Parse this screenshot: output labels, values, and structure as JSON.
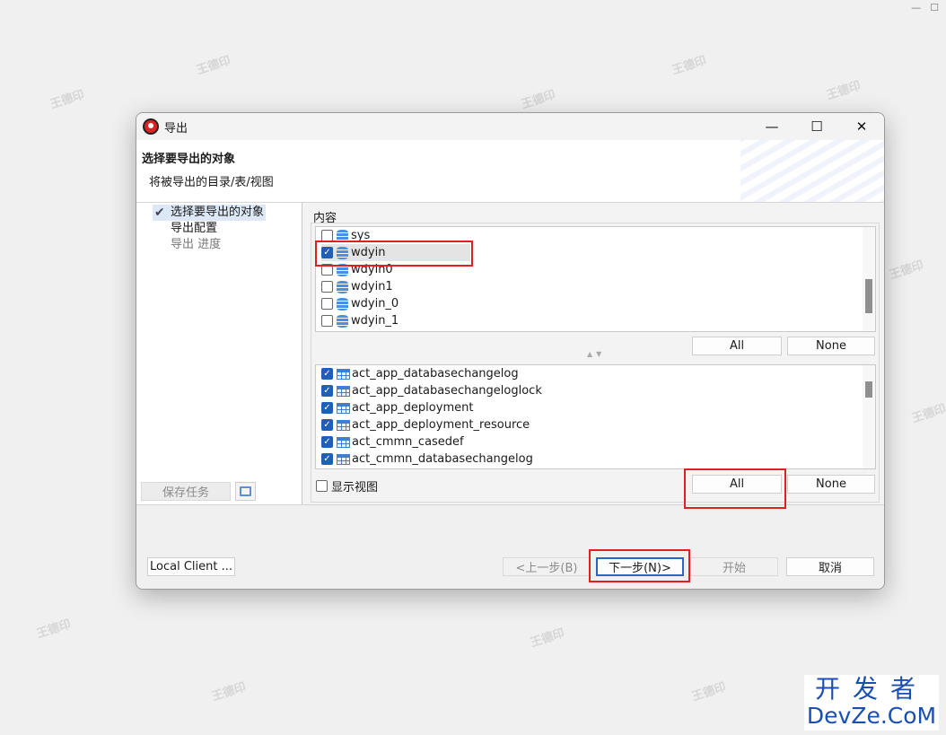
{
  "watermark_text": "王德印",
  "dialog": {
    "title": "导出",
    "window_controls": {
      "minimize": "—",
      "maximize": "☐",
      "close": "✕"
    },
    "header": {
      "title": "选择要导出的对象",
      "subtitle": "将被导出的目录/表/视图"
    },
    "nav": {
      "items": [
        {
          "label": "选择要导出的对象",
          "state": "current"
        },
        {
          "label": "导出配置",
          "state": "normal"
        },
        {
          "label": "导出 进度",
          "state": "disabled"
        }
      ],
      "save_task_label": "保存任务"
    },
    "content": {
      "label": "内容",
      "catalogs": [
        {
          "name": "sys",
          "checked": false
        },
        {
          "name": "wdyin",
          "checked": true
        },
        {
          "name": "wdyin0",
          "checked": false
        },
        {
          "name": "wdyin1",
          "checked": false
        },
        {
          "name": "wdyin_0",
          "checked": false
        },
        {
          "name": "wdyin_1",
          "checked": false
        }
      ],
      "catalog_buttons": {
        "all": "All",
        "none": "None"
      },
      "tables": [
        {
          "name": "act_app_databasechangelog",
          "checked": true
        },
        {
          "name": "act_app_databasechangeloglock",
          "checked": true
        },
        {
          "name": "act_app_deployment",
          "checked": true
        },
        {
          "name": "act_app_deployment_resource",
          "checked": true
        },
        {
          "name": "act_cmmn_casedef",
          "checked": true
        },
        {
          "name": "act_cmmn_databasechangelog",
          "checked": true
        }
      ],
      "table_buttons": {
        "all": "All",
        "none": "None"
      },
      "show_views_label": "显示视图",
      "show_views_checked": false
    },
    "footer": {
      "local_client": "Local Client ...",
      "prev": "<上一步(B)",
      "next": "下一步(N)>",
      "start": "开始",
      "cancel": "取消"
    }
  },
  "corner_logo": {
    "line1": "开发者",
    "line2": "DevZe.CoM"
  },
  "colors": {
    "highlight": "#e02020",
    "checkbox_checked": "#1f5fb8",
    "db_icon": "#4a90e2"
  }
}
